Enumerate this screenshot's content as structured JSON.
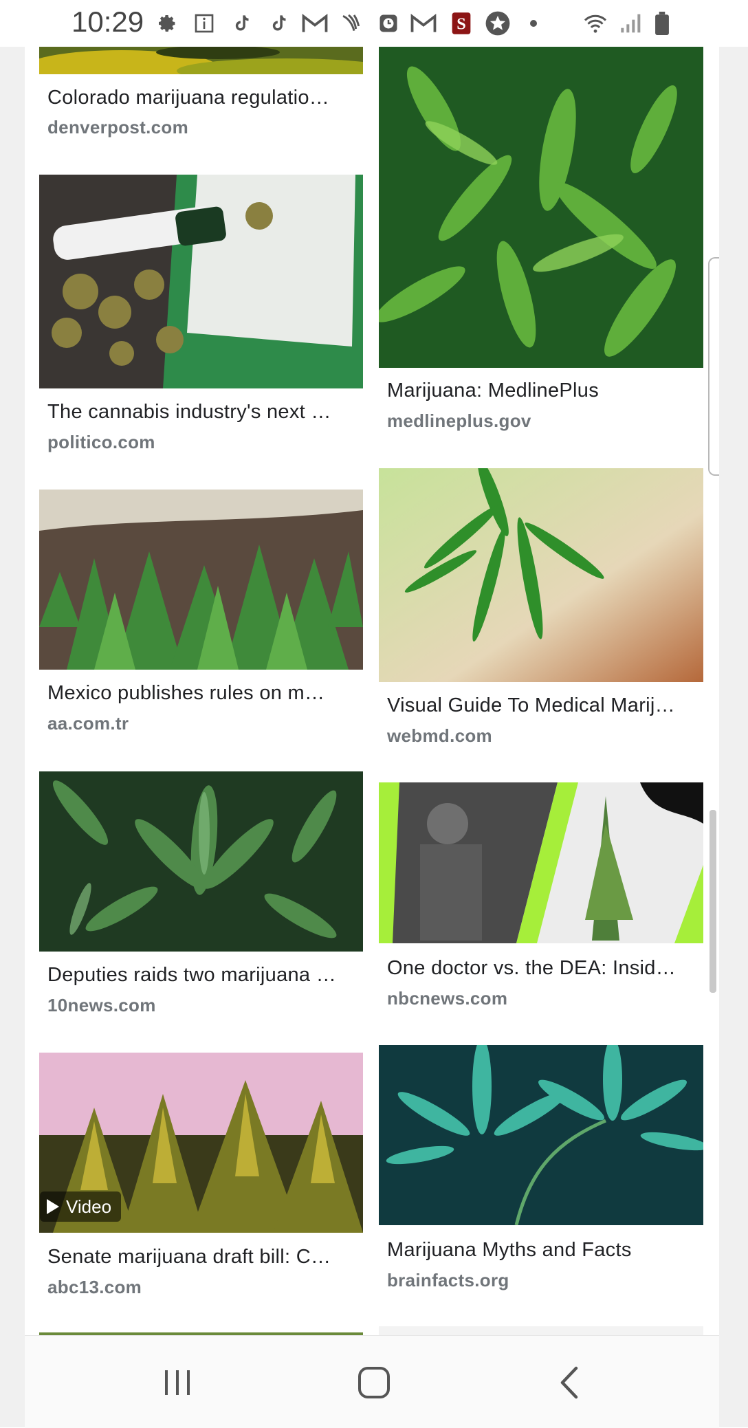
{
  "status_bar": {
    "time": "10:29",
    "icons": [
      "settings-icon",
      "info-icon",
      "tiktok-icon",
      "tiktok-icon",
      "gmail-icon",
      "sprint-icon",
      "clock-app-icon",
      "gmail-icon",
      "stanford-icon",
      "star-icon",
      "dot-icon",
      "wifi-icon",
      "signal-icon",
      "battery-icon"
    ]
  },
  "results": [
    {
      "title": "Colorado marijuana regulatio…",
      "source": "denverpost.com"
    },
    {
      "title": "Marijuana: MedlinePlus",
      "source": "medlineplus.gov"
    },
    {
      "title": "The cannabis industry's next …",
      "source": "politico.com"
    },
    {
      "title": "Visual Guide To Medical Marij…",
      "source": "webmd.com"
    },
    {
      "title": "Mexico publishes rules on m…",
      "source": "aa.com.tr"
    },
    {
      "title": "One doctor vs. the DEA: Insid…",
      "source": "nbcnews.com"
    },
    {
      "title": "Deputies raids two marijuana …",
      "source": "10news.com"
    },
    {
      "title": "Marijuana Myths and Facts",
      "source": "brainfacts.org"
    },
    {
      "title": "Senate marijuana draft bill: C…",
      "source": "abc13.com",
      "badge": "Video"
    }
  ],
  "colors": {
    "title": "#202124",
    "source": "#70757a",
    "leaf": "#3f8f2e",
    "frame": "#f0f0f0"
  },
  "nav": [
    "recent-apps-icon",
    "home-icon",
    "back-icon"
  ]
}
